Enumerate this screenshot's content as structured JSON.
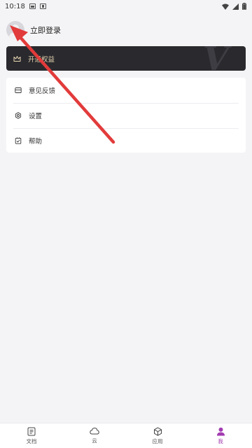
{
  "status_bar": {
    "time": "10:18"
  },
  "profile": {
    "login_label": "立即登录"
  },
  "vip": {
    "label": "开通权益"
  },
  "menu": {
    "items": [
      {
        "label": "意见反馈",
        "icon": "feedback-icon"
      },
      {
        "label": "设置",
        "icon": "settings-icon"
      },
      {
        "label": "帮助",
        "icon": "help-icon"
      }
    ]
  },
  "bottom_nav": {
    "items": [
      {
        "label": "文档",
        "icon": "document-icon"
      },
      {
        "label": "云",
        "icon": "cloud-icon"
      },
      {
        "label": "应用",
        "icon": "apps-icon"
      },
      {
        "label": "我",
        "icon": "person-icon",
        "active": true
      }
    ]
  },
  "colors": {
    "vip_bg": "#2a2a2e",
    "vip_text": "#e9d6b2",
    "accent": "#a23cb1",
    "annotation_arrow": "#e23b3b"
  }
}
